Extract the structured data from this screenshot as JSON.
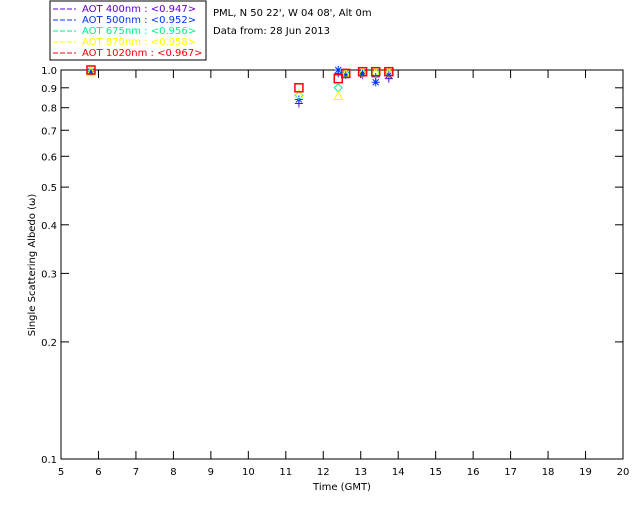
{
  "header": {
    "site": "PML, N 50 22', W 04 08', Alt 0m",
    "date": "Data from: 28 Jun 2013"
  },
  "chart_data": {
    "type": "scatter",
    "xlabel": "Time (GMT)",
    "ylabel": "Single Scattering Albedo (ω)",
    "xlim": [
      5,
      20
    ],
    "ylim": [
      0.1,
      1.0
    ],
    "yscale": "log",
    "xticks": [
      5,
      6,
      7,
      8,
      9,
      10,
      11,
      12,
      13,
      14,
      15,
      16,
      17,
      18,
      19,
      20
    ],
    "yticks": [
      0.1,
      0.2,
      0.3,
      0.4,
      0.5,
      0.6,
      0.7,
      0.8,
      0.9,
      1.0
    ],
    "ytick_labels": [
      "0.1",
      "0.2",
      "0.3",
      "0.4",
      "0.5",
      "0.6",
      "0.7",
      "0.8",
      "0.9",
      "1.0"
    ],
    "legend_position": "top-left outside",
    "series": [
      {
        "name": "AOT  400nm : <0.947>",
        "color": "#6600cc",
        "marker": "plus",
        "x": [
          5.8,
          11.35,
          12.4,
          13.05,
          13.4,
          13.75
        ],
        "y": [
          0.99,
          0.82,
          0.98,
          0.97,
          0.96,
          0.95
        ]
      },
      {
        "name": "AOT  500nm : <0.952>",
        "color": "#0033ff",
        "marker": "asterisk",
        "x": [
          5.8,
          11.35,
          12.4,
          12.6,
          13.05,
          13.4,
          13.75
        ],
        "y": [
          0.99,
          0.84,
          1.0,
          0.97,
          0.98,
          0.93,
          0.97
        ]
      },
      {
        "name": "AOT  675nm : <0.956>",
        "color": "#00ee88",
        "marker": "diamond",
        "x": [
          5.8,
          11.35,
          12.4,
          12.6,
          13.05,
          13.4,
          13.75
        ],
        "y": [
          0.99,
          0.86,
          0.9,
          0.98,
          0.98,
          0.98,
          0.98
        ]
      },
      {
        "name": "AOT  870nm : <0.958>",
        "color": "#ffff00",
        "marker": "triangle",
        "x": [
          5.8,
          11.35,
          12.4,
          12.6,
          13.05,
          13.4,
          13.75
        ],
        "y": [
          0.99,
          0.87,
          0.86,
          0.98,
          0.99,
          0.99,
          0.99
        ]
      },
      {
        "name": "AOT 1020nm : <0.967>",
        "color": "#ff0000",
        "marker": "square",
        "x": [
          5.8,
          11.35,
          12.4,
          12.6,
          13.05,
          13.4,
          13.75
        ],
        "y": [
          1.0,
          0.9,
          0.95,
          0.98,
          0.99,
          0.99,
          0.99
        ]
      }
    ]
  }
}
